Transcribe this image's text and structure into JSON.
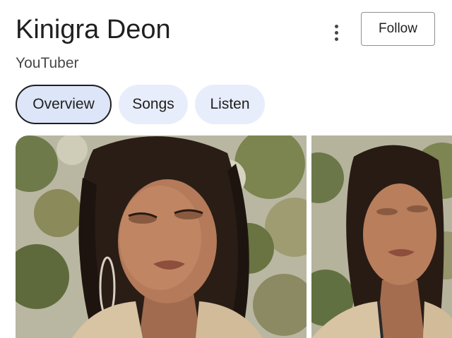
{
  "header": {
    "title": "Kinigra Deon",
    "subtitle": "YouTuber",
    "follow_label": "Follow",
    "more_icon": "more-vert-icon"
  },
  "tabs": [
    {
      "label": "Overview",
      "active": true
    },
    {
      "label": "Songs",
      "active": false
    },
    {
      "label": "Listen",
      "active": false
    }
  ],
  "colors": {
    "tab_background": "#e8edfb",
    "active_tab_border": "#1f1f1f",
    "follow_border": "#8e918f",
    "title_text": "#1f1f1f"
  }
}
